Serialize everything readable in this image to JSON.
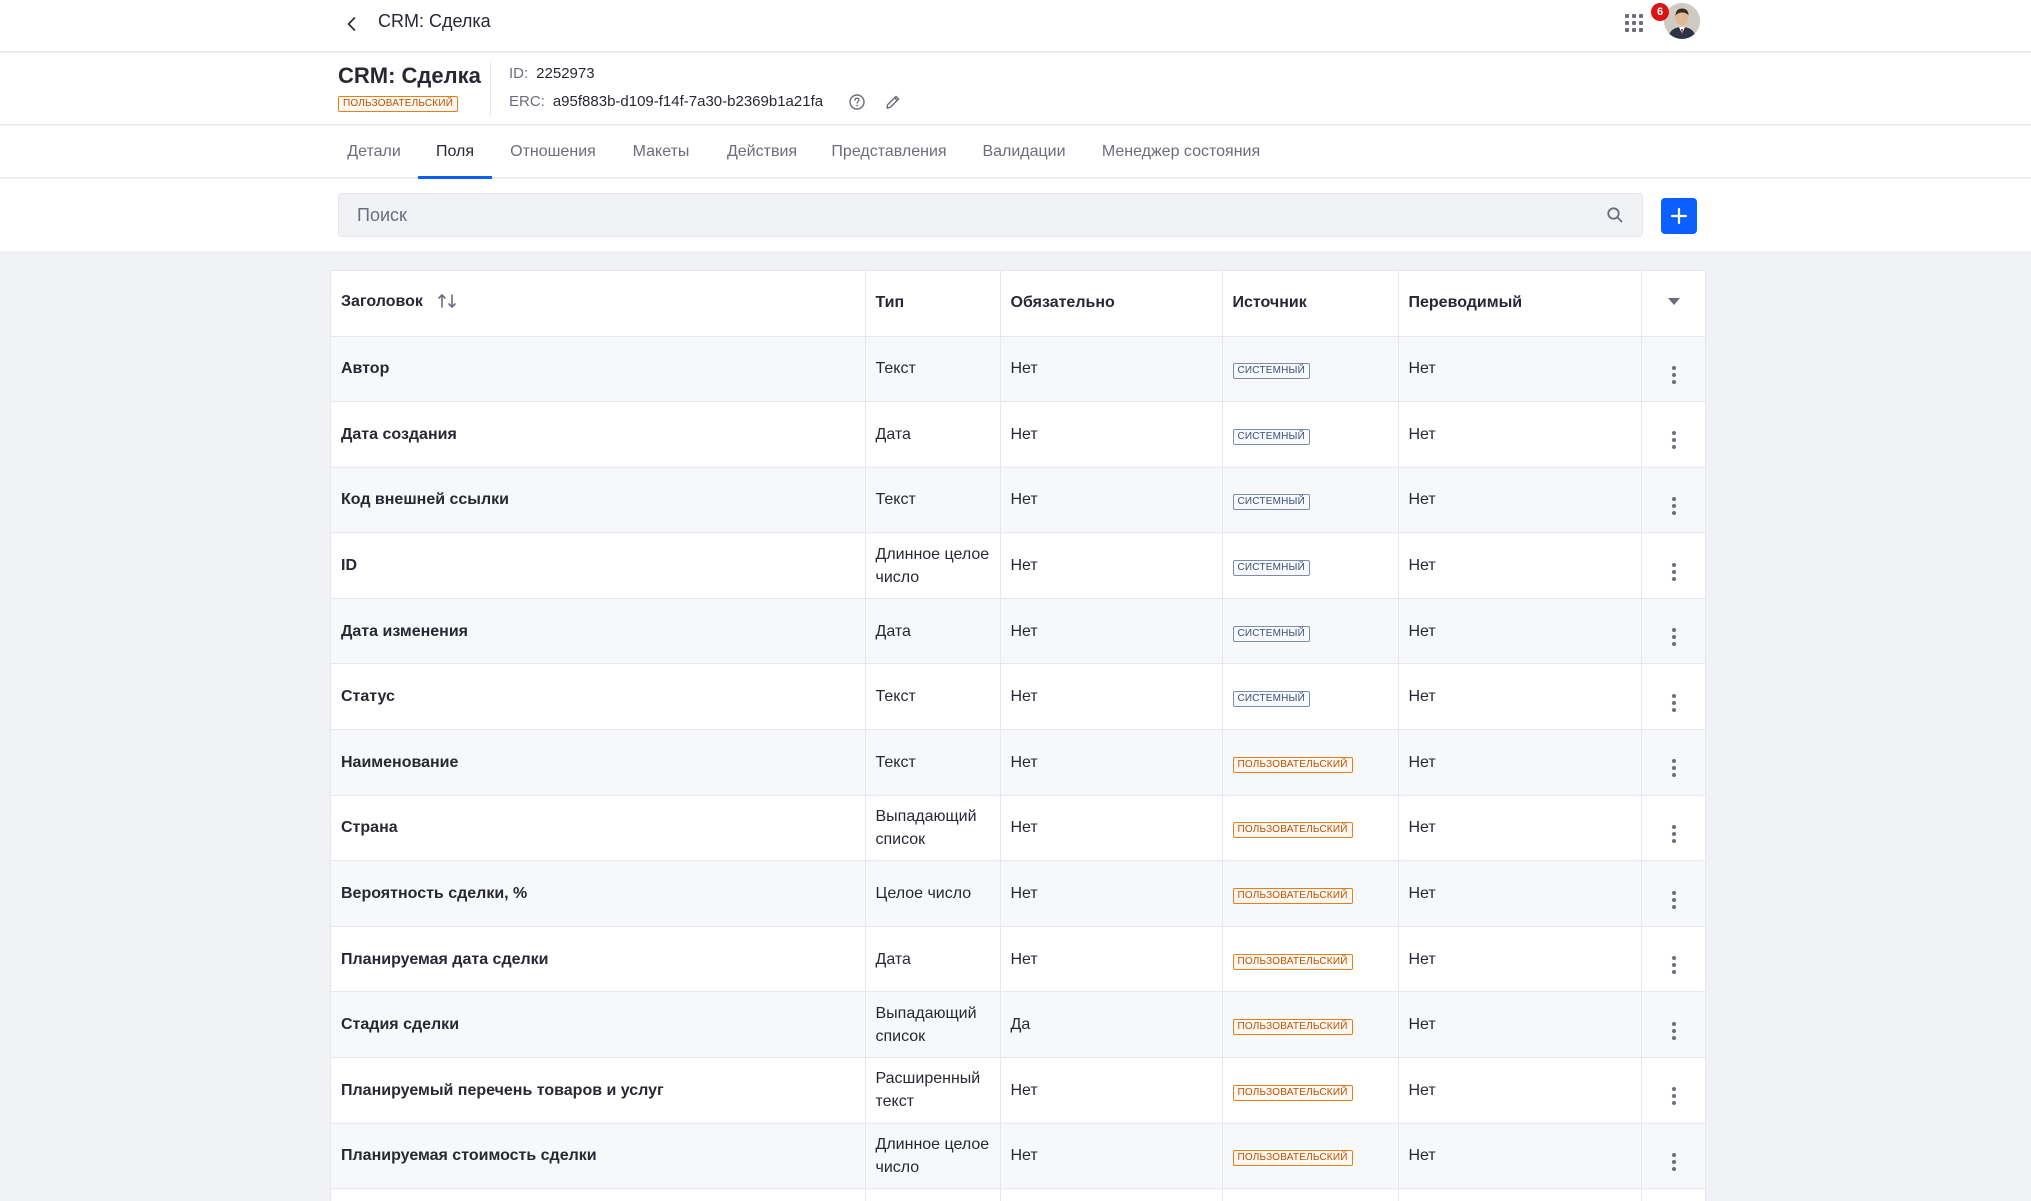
{
  "topbar": {
    "title": "CRM: Сделка",
    "notification_count": "6"
  },
  "header": {
    "object_title": "CRM: Сделка",
    "object_badge": "ПОЛЬЗОВАТЕЛЬСКИЙ",
    "id_label": "ID:",
    "id_value": "2252973",
    "erc_label": "ERC:",
    "erc_value": "a95f883b-d109-f14f-7a30-b2369b1a21fa"
  },
  "tabs": [
    {
      "label": "Детали",
      "active": false
    },
    {
      "label": "Поля",
      "active": true
    },
    {
      "label": "Отношения",
      "active": false
    },
    {
      "label": "Макеты",
      "active": false
    },
    {
      "label": "Действия",
      "active": false
    },
    {
      "label": "Представления",
      "active": false
    },
    {
      "label": "Валидации",
      "active": false
    },
    {
      "label": "Менеджер состояния",
      "active": false
    }
  ],
  "search": {
    "placeholder": "Поиск"
  },
  "table": {
    "columns": [
      "Заголовок",
      "Тип",
      "Обязательно",
      "Источник",
      "Переводимый"
    ],
    "rows": [
      {
        "title": "Автор",
        "type": "Текст",
        "required": "Нет",
        "source": "СИСТЕМНЫЙ",
        "source_kind": "system",
        "translatable": "Нет"
      },
      {
        "title": "Дата создания",
        "type": "Дата",
        "required": "Нет",
        "source": "СИСТЕМНЫЙ",
        "source_kind": "system",
        "translatable": "Нет"
      },
      {
        "title": "Код внешней ссылки",
        "type": "Текст",
        "required": "Нет",
        "source": "СИСТЕМНЫЙ",
        "source_kind": "system",
        "translatable": "Нет"
      },
      {
        "title": "ID",
        "type": "Длинное целое число",
        "required": "Нет",
        "source": "СИСТЕМНЫЙ",
        "source_kind": "system",
        "translatable": "Нет"
      },
      {
        "title": "Дата изменения",
        "type": "Дата",
        "required": "Нет",
        "source": "СИСТЕМНЫЙ",
        "source_kind": "system",
        "translatable": "Нет"
      },
      {
        "title": "Статус",
        "type": "Текст",
        "required": "Нет",
        "source": "СИСТЕМНЫЙ",
        "source_kind": "system",
        "translatable": "Нет"
      },
      {
        "title": "Наименование",
        "type": "Текст",
        "required": "Нет",
        "source": "ПОЛЬЗОВАТЕЛЬСКИЙ",
        "source_kind": "custom",
        "translatable": "Нет"
      },
      {
        "title": "Страна",
        "type": "Выпадающий список",
        "required": "Нет",
        "source": "ПОЛЬЗОВАТЕЛЬСКИЙ",
        "source_kind": "custom",
        "translatable": "Нет"
      },
      {
        "title": "Вероятность сделки, %",
        "type": "Целое число",
        "required": "Нет",
        "source": "ПОЛЬЗОВАТЕЛЬСКИЙ",
        "source_kind": "custom",
        "translatable": "Нет"
      },
      {
        "title": "Планируемая дата сделки",
        "type": "Дата",
        "required": "Нет",
        "source": "ПОЛЬЗОВАТЕЛЬСКИЙ",
        "source_kind": "custom",
        "translatable": "Нет"
      },
      {
        "title": "Стадия сделки",
        "type": "Выпадающий список",
        "required": "Да",
        "source": "ПОЛЬЗОВАТЕЛЬСКИЙ",
        "source_kind": "custom",
        "translatable": "Нет"
      },
      {
        "title": "Планируемый перечень товаров и услуг",
        "type": "Расширенный текст",
        "required": "Нет",
        "source": "ПОЛЬЗОВАТЕЛЬСКИЙ",
        "source_kind": "custom",
        "translatable": "Нет"
      },
      {
        "title": "Планируемая стоимость сделки",
        "type": "Длинное целое число",
        "required": "Нет",
        "source": "ПОЛЬЗОВАТЕЛЬСКИЙ",
        "source_kind": "custom",
        "translatable": "Нет"
      },
      {
        "title": "",
        "type": "",
        "required": "",
        "source": "",
        "source_kind": "",
        "translatable": ""
      }
    ]
  },
  "colors": {
    "accent": "#0b5fff",
    "notification": "#da1414",
    "custom_badge": "#e57e1c",
    "system_badge": "#7b8db0"
  }
}
